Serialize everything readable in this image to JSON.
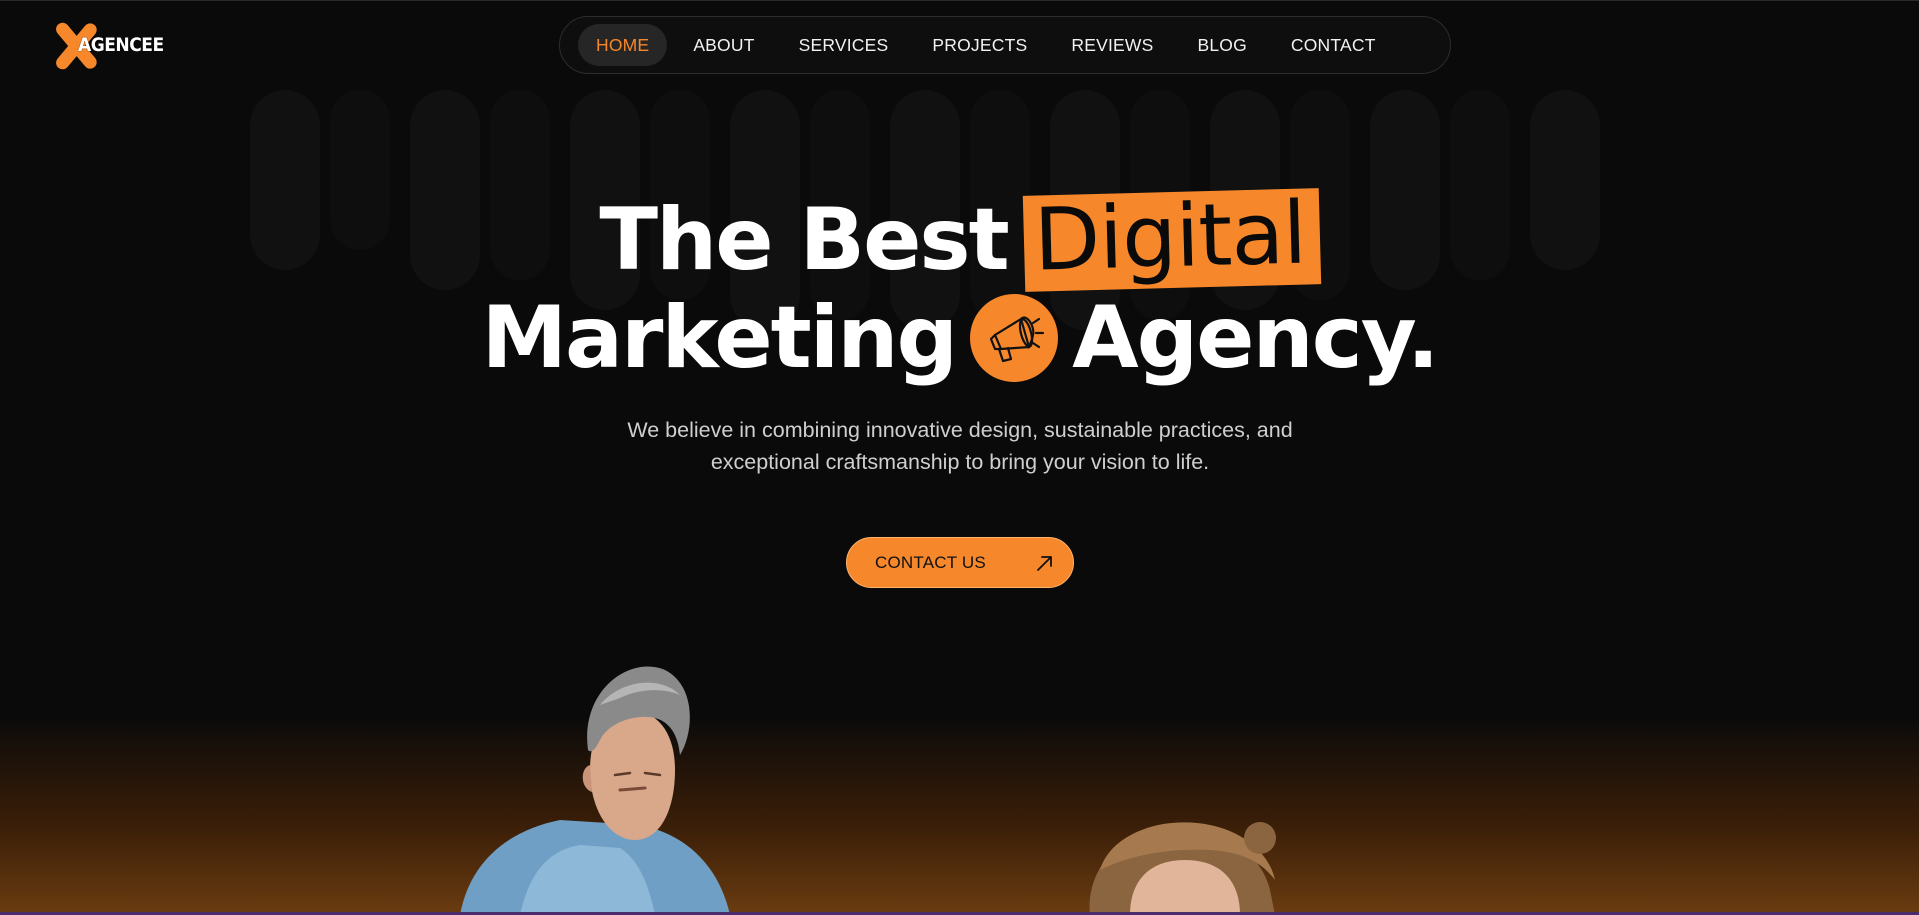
{
  "brand": {
    "logo_text": "AGENCEE",
    "accent_color": "#f6872a",
    "background": "#0a0a0a"
  },
  "nav": {
    "items": [
      {
        "label": "HOME",
        "active": true
      },
      {
        "label": "ABOUT"
      },
      {
        "label": "SERVICES"
      },
      {
        "label": "PROJECTS"
      },
      {
        "label": "REVIEWS"
      },
      {
        "label": "BLOG"
      },
      {
        "label": "CONTACT"
      }
    ]
  },
  "hero": {
    "headline_part1": "The Best",
    "headline_highlight": "Digital",
    "headline_part2": "Marketing",
    "headline_part3": "Agency.",
    "headline_icon": "megaphone-icon",
    "description": "We believe in combining innovative design, sustainable practices, and exceptional craftsmanship to bring your vision to life.",
    "cta_label": "CONTACT US",
    "cta_icon": "arrow-up-right-icon"
  },
  "images": {
    "person_left": "man-with-gray-hair-photo",
    "person_right": "person-with-curly-hair-photo"
  }
}
